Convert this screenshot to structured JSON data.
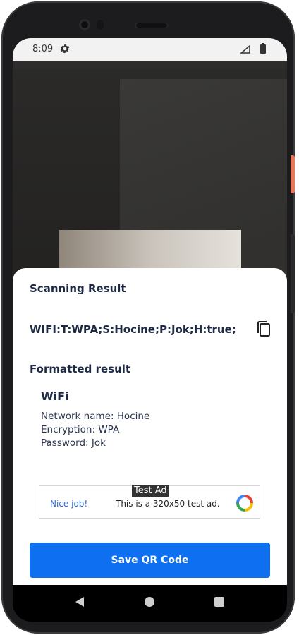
{
  "status_bar": {
    "time": "8:09"
  },
  "result_sheet": {
    "title": "Scanning Result",
    "raw_text": "WIFI:T:WPA;S:Hocine;P:Jok;H:true;",
    "formatted_title": "Formatted result",
    "wifi": {
      "title": "WiFi",
      "network": "Network name: Hocine",
      "encryption": "Encryption: WPA",
      "password": "Password: Jok"
    }
  },
  "ad": {
    "badge": "Test Ad",
    "nice": "Nice job!",
    "text": "This is a 320x50 test ad."
  },
  "save_button": {
    "label": "Save QR Code"
  },
  "colors": {
    "accent": "#0e6ff0",
    "title_text": "#1e2a44"
  }
}
